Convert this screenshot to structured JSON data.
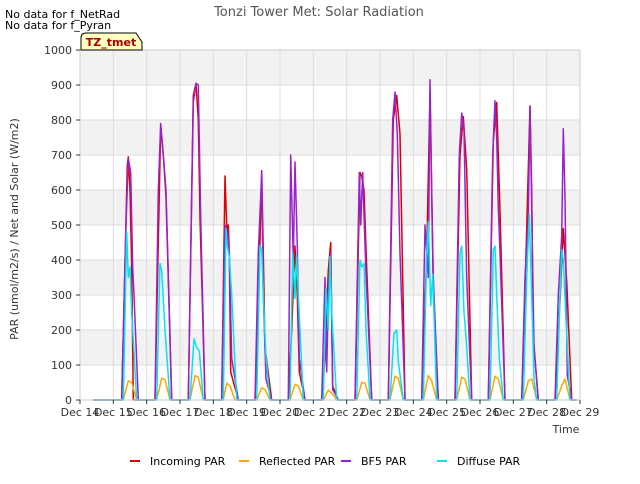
{
  "notes": [
    "No data for f_NetRad",
    "No data for f_Pyran"
  ],
  "site_tag": "TZ_tmet",
  "chart_data": {
    "type": "line",
    "title": "Tonzi Tower Met: Solar Radiation",
    "xlabel": "Time",
    "ylabel": "PAR (umol/m2/s) / Net and Solar (W/m2)",
    "ylim": [
      0,
      1000
    ],
    "xlim": [
      14,
      29
    ],
    "yticks": [
      0,
      100,
      200,
      300,
      400,
      500,
      600,
      700,
      800,
      900,
      1000
    ],
    "xticks": [
      14,
      15,
      16,
      17,
      18,
      19,
      20,
      21,
      22,
      23,
      24,
      25,
      26,
      27,
      28,
      29
    ],
    "xtick_labels": [
      "Dec 14",
      "Dec 15",
      "Dec 16",
      "Dec 17",
      "Dec 18",
      "Dec 19",
      "Dec 20",
      "Dec 21",
      "Dec 22",
      "Dec 23",
      "Dec 24",
      "Dec 25",
      "Dec 26",
      "Dec 27",
      "Dec 28",
      "Dec 29"
    ],
    "grid": true,
    "background_bands": true,
    "legend_position": "bottom",
    "series": [
      {
        "name": "Incoming PAR",
        "color": "#dd0000",
        "x": [
          14.4,
          15.25,
          15.42,
          15.45,
          15.5,
          15.55,
          15.6,
          15.75,
          16.25,
          16.42,
          16.5,
          16.58,
          16.75,
          17.25,
          17.4,
          17.48,
          17.55,
          17.6,
          17.75,
          18.25,
          18.35,
          18.42,
          18.45,
          18.48,
          18.52,
          18.75,
          19.25,
          19.35,
          19.45,
          19.5,
          19.55,
          19.75,
          20.25,
          20.35,
          20.45,
          20.52,
          20.58,
          20.75,
          21.25,
          21.35,
          21.45,
          21.52,
          21.58,
          21.75,
          22.25,
          22.4,
          22.45,
          22.52,
          22.58,
          22.75,
          23.25,
          23.4,
          23.5,
          23.6,
          23.75,
          24.25,
          24.4,
          24.5,
          24.55,
          24.6,
          24.75,
          25.25,
          25.4,
          25.5,
          25.6,
          25.75,
          26.25,
          26.4,
          26.5,
          26.55,
          26.6,
          26.75,
          27.25,
          27.35,
          27.5,
          27.55,
          27.6,
          27.75,
          28.25,
          28.35,
          28.5,
          28.6,
          28.75,
          28.9
        ],
        "y": [
          0,
          0,
          670,
          695,
          600,
          380,
          0,
          0,
          0,
          780,
          700,
          580,
          0,
          0,
          870,
          905,
          800,
          520,
          0,
          0,
          640,
          450,
          500,
          420,
          80,
          0,
          0,
          250,
          655,
          420,
          150,
          0,
          0,
          200,
          440,
          300,
          80,
          0,
          0,
          120,
          370,
          450,
          40,
          0,
          0,
          650,
          640,
          600,
          430,
          0,
          0,
          800,
          870,
          760,
          0,
          0,
          410,
          880,
          590,
          310,
          0,
          0,
          700,
          810,
          660,
          0,
          0,
          740,
          850,
          700,
          540,
          0,
          0,
          310,
          840,
          600,
          180,
          0,
          0,
          180,
          490,
          340,
          0,
          0
        ]
      },
      {
        "name": "Reflected PAR",
        "color": "#ffa500",
        "x": [
          14.4,
          15.3,
          15.45,
          15.55,
          15.7,
          16.3,
          16.45,
          16.55,
          16.7,
          17.3,
          17.45,
          17.55,
          17.7,
          18.3,
          18.4,
          18.5,
          18.65,
          19.3,
          19.45,
          19.55,
          19.7,
          20.3,
          20.45,
          20.55,
          20.7,
          21.3,
          21.45,
          21.55,
          21.7,
          22.3,
          22.45,
          22.55,
          22.7,
          23.3,
          23.45,
          23.55,
          23.7,
          24.3,
          24.45,
          24.55,
          24.7,
          25.3,
          25.45,
          25.55,
          25.7,
          26.3,
          26.45,
          26.55,
          26.7,
          27.3,
          27.45,
          27.55,
          27.7,
          28.3,
          28.45,
          28.55,
          28.7,
          28.9
        ],
        "y": [
          0,
          0,
          55,
          50,
          0,
          0,
          62,
          58,
          0,
          0,
          70,
          65,
          0,
          0,
          48,
          40,
          0,
          0,
          35,
          30,
          0,
          0,
          45,
          40,
          0,
          0,
          28,
          20,
          0,
          0,
          50,
          48,
          0,
          0,
          68,
          62,
          0,
          0,
          70,
          55,
          0,
          0,
          65,
          60,
          0,
          0,
          68,
          60,
          0,
          0,
          55,
          60,
          0,
          0,
          40,
          60,
          0,
          0
        ]
      },
      {
        "name": "BF5 PAR",
        "color": "#9922cc",
        "x": [
          14.4,
          15.25,
          15.38,
          15.45,
          15.52,
          15.58,
          15.62,
          15.75,
          16.25,
          16.35,
          16.42,
          16.5,
          16.58,
          16.75,
          17.25,
          17.4,
          17.48,
          17.55,
          17.62,
          17.75,
          18.25,
          18.35,
          18.42,
          18.48,
          18.55,
          18.75,
          19.25,
          19.35,
          19.45,
          19.5,
          19.58,
          19.75,
          20.25,
          20.32,
          20.4,
          20.45,
          20.52,
          20.58,
          20.75,
          21.25,
          21.35,
          21.4,
          21.45,
          21.52,
          21.58,
          21.75,
          22.25,
          22.38,
          22.42,
          22.48,
          22.52,
          22.58,
          22.75,
          23.25,
          23.38,
          23.45,
          23.52,
          23.6,
          23.75,
          24.25,
          24.35,
          24.45,
          24.5,
          24.55,
          24.6,
          24.75,
          25.25,
          25.38,
          25.45,
          25.52,
          25.6,
          25.75,
          26.25,
          26.38,
          26.45,
          26.5,
          26.55,
          26.6,
          26.75,
          27.25,
          27.35,
          27.45,
          27.5,
          27.55,
          27.62,
          27.75,
          28.25,
          28.35,
          28.45,
          28.5,
          28.55,
          28.62,
          28.75,
          28.9
        ],
        "y": [
          0,
          0,
          500,
          690,
          650,
          380,
          300,
          0,
          0,
          600,
          790,
          700,
          600,
          0,
          0,
          850,
          905,
          900,
          520,
          0,
          0,
          500,
          480,
          420,
          120,
          0,
          0,
          420,
          650,
          300,
          60,
          0,
          0,
          700,
          400,
          680,
          440,
          120,
          0,
          0,
          350,
          80,
          300,
          420,
          30,
          0,
          0,
          650,
          500,
          650,
          530,
          360,
          0,
          0,
          800,
          880,
          760,
          420,
          0,
          0,
          500,
          350,
          915,
          600,
          350,
          0,
          0,
          700,
          820,
          770,
          350,
          0,
          0,
          700,
          855,
          750,
          550,
          420,
          0,
          0,
          350,
          520,
          840,
          550,
          150,
          0,
          0,
          300,
          470,
          775,
          580,
          70,
          0,
          0
        ]
      },
      {
        "name": "Diffuse PAR",
        "color": "#00e5ee",
        "x": [
          14.4,
          15.3,
          15.4,
          15.45,
          15.5,
          15.55,
          15.7,
          16.3,
          16.4,
          16.45,
          16.55,
          16.7,
          17.3,
          17.42,
          17.5,
          17.58,
          17.7,
          18.3,
          18.38,
          18.42,
          18.48,
          18.55,
          18.7,
          19.3,
          19.4,
          19.45,
          19.5,
          19.58,
          19.7,
          20.3,
          20.38,
          20.45,
          20.5,
          20.55,
          20.7,
          21.3,
          21.38,
          21.45,
          21.5,
          21.55,
          21.7,
          22.3,
          22.4,
          22.45,
          22.52,
          22.58,
          22.7,
          23.3,
          23.42,
          23.5,
          23.55,
          23.7,
          24.3,
          24.4,
          24.45,
          24.52,
          24.58,
          24.7,
          25.3,
          25.4,
          25.45,
          25.52,
          25.58,
          25.7,
          26.3,
          26.4,
          26.45,
          26.5,
          26.58,
          26.7,
          27.3,
          27.4,
          27.48,
          27.55,
          27.62,
          27.7,
          28.3,
          28.4,
          28.45,
          28.5,
          28.58,
          28.7,
          28.9
        ],
        "y": [
          0,
          0,
          480,
          350,
          380,
          250,
          0,
          0,
          390,
          370,
          200,
          0,
          0,
          175,
          150,
          140,
          0,
          0,
          490,
          440,
          410,
          300,
          0,
          0,
          440,
          430,
          300,
          120,
          0,
          0,
          420,
          290,
          415,
          300,
          0,
          0,
          320,
          200,
          410,
          250,
          0,
          0,
          400,
          380,
          390,
          200,
          0,
          0,
          190,
          200,
          110,
          0,
          0,
          420,
          510,
          270,
          360,
          0,
          0,
          420,
          440,
          250,
          180,
          0,
          0,
          430,
          440,
          300,
          120,
          0,
          0,
          350,
          530,
          300,
          60,
          0,
          0,
          300,
          430,
          400,
          230,
          0,
          0
        ]
      }
    ]
  }
}
